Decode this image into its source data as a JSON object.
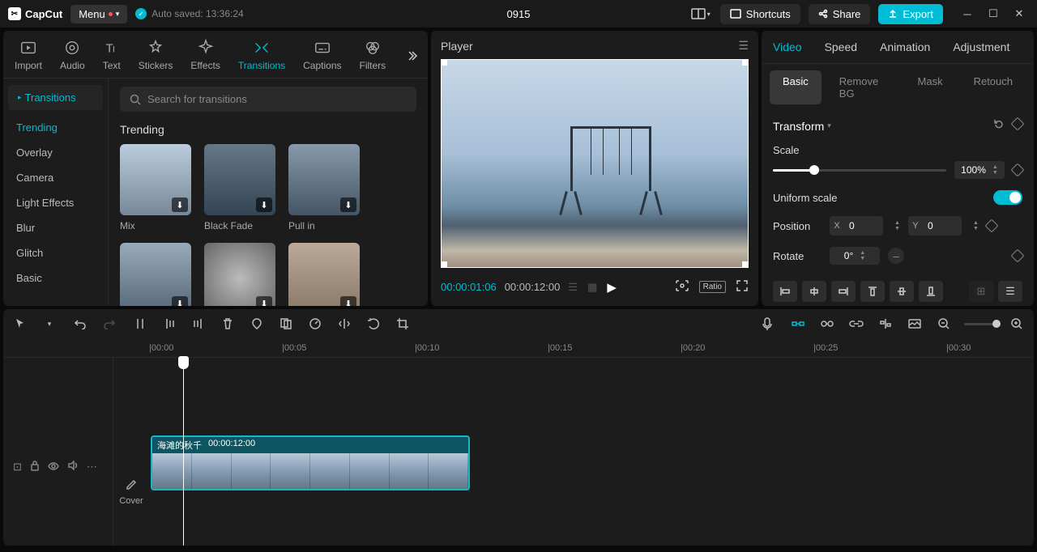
{
  "app": {
    "name": "CapCut",
    "menu": "Menu",
    "autosave": "Auto saved: 13:36:24",
    "title": "0915"
  },
  "topButtons": {
    "shortcuts": "Shortcuts",
    "share": "Share",
    "export": "Export"
  },
  "navTabs": [
    "Import",
    "Audio",
    "Text",
    "Stickers",
    "Effects",
    "Transitions",
    "Captions",
    "Filters"
  ],
  "navActive": "Transitions",
  "sidebar": {
    "title": "Transitions",
    "items": [
      "Trending",
      "Overlay",
      "Camera",
      "Light Effects",
      "Blur",
      "Glitch",
      "Basic"
    ],
    "active": "Trending"
  },
  "search": {
    "placeholder": "Search for transitions"
  },
  "section": {
    "title": "Trending"
  },
  "thumbs": [
    {
      "label": "Mix"
    },
    {
      "label": "Black Fade"
    },
    {
      "label": "Pull in"
    },
    {
      "label": ""
    },
    {
      "label": ""
    },
    {
      "label": ""
    }
  ],
  "player": {
    "title": "Player",
    "current": "00:00:01:06",
    "duration": "00:00:12:00",
    "ratio": "Ratio"
  },
  "inspector": {
    "tabs": [
      "Video",
      "Speed",
      "Animation",
      "Adjustment"
    ],
    "tabActive": "Video",
    "subtabs": [
      "Basic",
      "Remove BG",
      "Mask",
      "Retouch"
    ],
    "subActive": "Basic",
    "transform": "Transform",
    "scale": {
      "label": "Scale",
      "value": "100%"
    },
    "uniform": {
      "label": "Uniform scale"
    },
    "position": {
      "label": "Position",
      "x": "0",
      "y": "0"
    },
    "rotate": {
      "label": "Rotate",
      "value": "0°"
    }
  },
  "ruler": [
    "00:00",
    "00:05",
    "00:10",
    "00:15",
    "00:20",
    "00:25",
    "00:30"
  ],
  "cover": "Cover",
  "clip": {
    "name": "海滩的秋千",
    "duration": "00:00:12:00"
  }
}
